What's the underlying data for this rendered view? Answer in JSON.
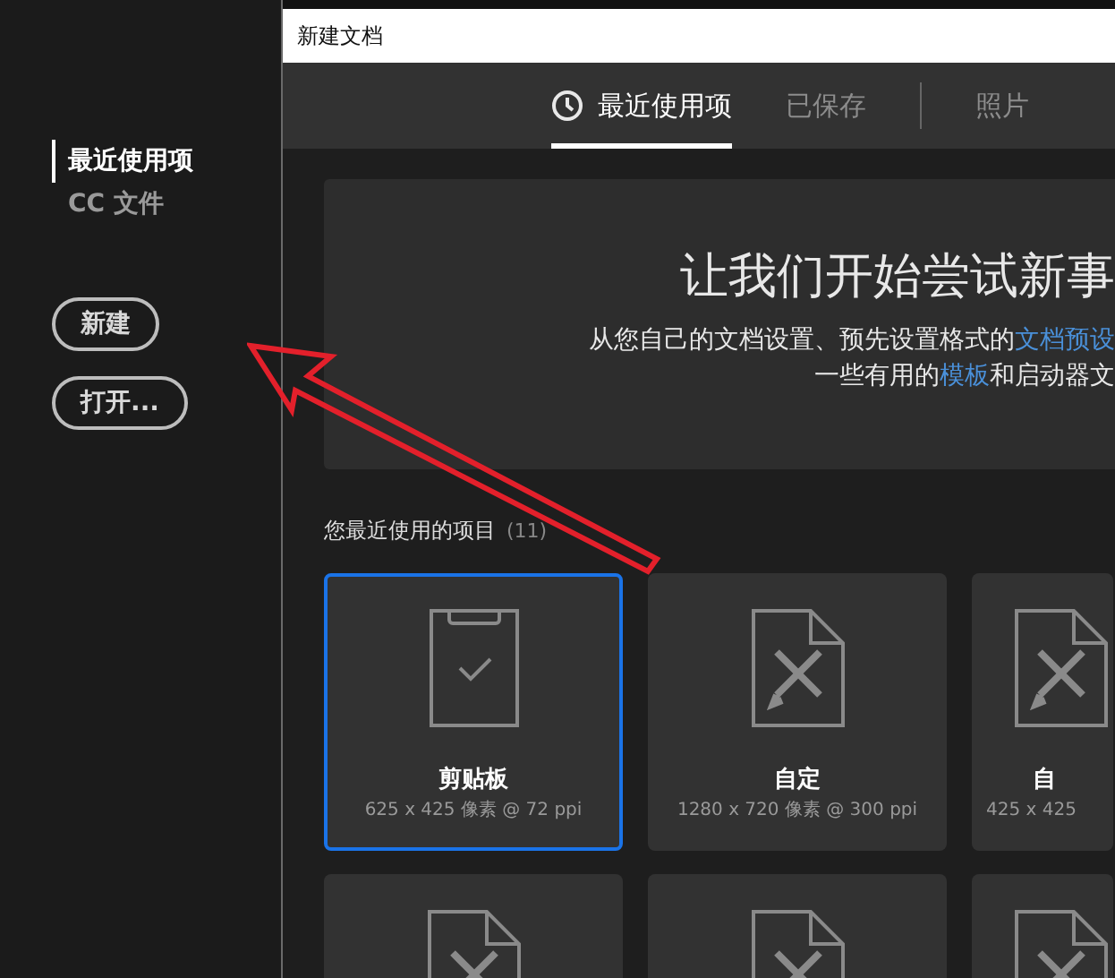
{
  "sidebar": {
    "items": [
      {
        "label": "最近使用项",
        "selected": true
      },
      {
        "label": "CC 文件",
        "selected": false
      }
    ],
    "buttons": [
      "新建",
      "打开..."
    ]
  },
  "window": {
    "title": "新建文档"
  },
  "tabs": [
    {
      "label": "最近使用项",
      "selected": true,
      "kind": "clock"
    },
    {
      "label": "已保存",
      "selected": false,
      "kind": "plain"
    },
    {
      "label": "照片",
      "selected": false,
      "kind": "plain"
    }
  ],
  "hero": {
    "title": "让我们开始尝试新事",
    "lines": [
      [
        {
          "kind": "text",
          "text": "从您自己的文档设置、预先设置格式的"
        },
        {
          "kind": "link",
          "text": "文档预设"
        }
      ],
      [
        {
          "kind": "text",
          "text": "一些有用的"
        },
        {
          "kind": "link",
          "text": "模板"
        },
        {
          "kind": "text",
          "text": "和启动器文"
        }
      ]
    ]
  },
  "recent": {
    "heading": "您最近使用的项目",
    "count": "(11)"
  },
  "card_rows": [
    [
      {
        "kind": "clipboard",
        "name": "剪贴板",
        "size": "625 x 425 像素 @ 72 ppi",
        "selected": true
      },
      {
        "kind": "custom",
        "name": "自定",
        "size": "1280 x 720 像素 @ 300 ppi",
        "selected": false
      },
      {
        "kind": "custom",
        "name": "自",
        "size": "425 x 425",
        "selected": false
      }
    ],
    [
      {
        "kind": "custom",
        "selected": false
      },
      {
        "kind": "custom",
        "selected": false
      },
      {
        "kind": "custom",
        "selected": false
      }
    ]
  ]
}
